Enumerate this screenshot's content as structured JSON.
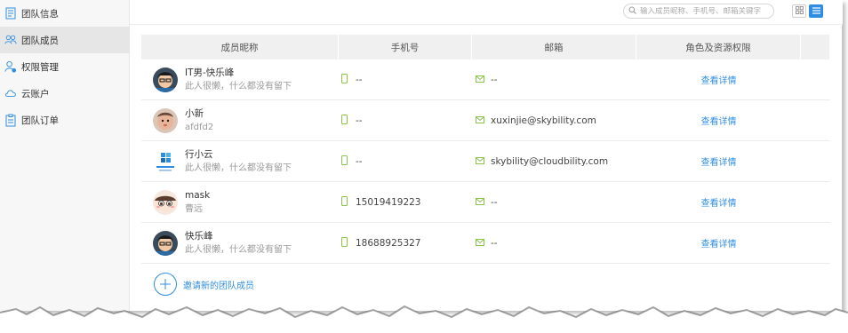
{
  "sidebar": {
    "items": [
      {
        "label": "团队信息",
        "icon": "document-icon",
        "active": false
      },
      {
        "label": "团队成员",
        "icon": "members-icon",
        "active": true
      },
      {
        "label": "权限管理",
        "icon": "user-settings-icon",
        "active": false
      },
      {
        "label": "云账户",
        "icon": "cloud-icon",
        "active": false
      },
      {
        "label": "团队订单",
        "icon": "clipboard-icon",
        "active": false
      }
    ]
  },
  "search": {
    "placeholder": "输入成员昵称、手机号、邮箱关键字"
  },
  "table": {
    "headers": [
      "成员昵称",
      "手机号",
      "邮箱",
      "角色及资源权限"
    ],
    "rows": [
      {
        "nickname": "IT男-快乐峰",
        "signature": "此人很懒，什么都没有留下",
        "phone": "--",
        "email": "--",
        "action": "查看详情"
      },
      {
        "nickname": "小新",
        "signature": "afdfd2",
        "phone": "--",
        "email": "xuxinjie@skybility.com",
        "action": "查看详情"
      },
      {
        "nickname": "行小云",
        "signature": "此人很懒，什么都没有留下",
        "phone": "--",
        "email": "skybility@cloudbility.com",
        "action": "查看详情"
      },
      {
        "nickname": "mask",
        "signature": "曹远",
        "phone": "15019419223",
        "email": "--",
        "action": "查看详情"
      },
      {
        "nickname": "快乐峰",
        "signature": "此人很懒，什么都没有留下",
        "phone": "18688925327",
        "email": "--",
        "action": "查看详情"
      }
    ]
  },
  "invite": {
    "label": "邀请新的团队成员"
  },
  "colors": {
    "accent": "#2f8ee0",
    "phone_icon": "#8bc34a",
    "email_icon": "#8bc34a",
    "active_bg": "#e6e6e6"
  }
}
